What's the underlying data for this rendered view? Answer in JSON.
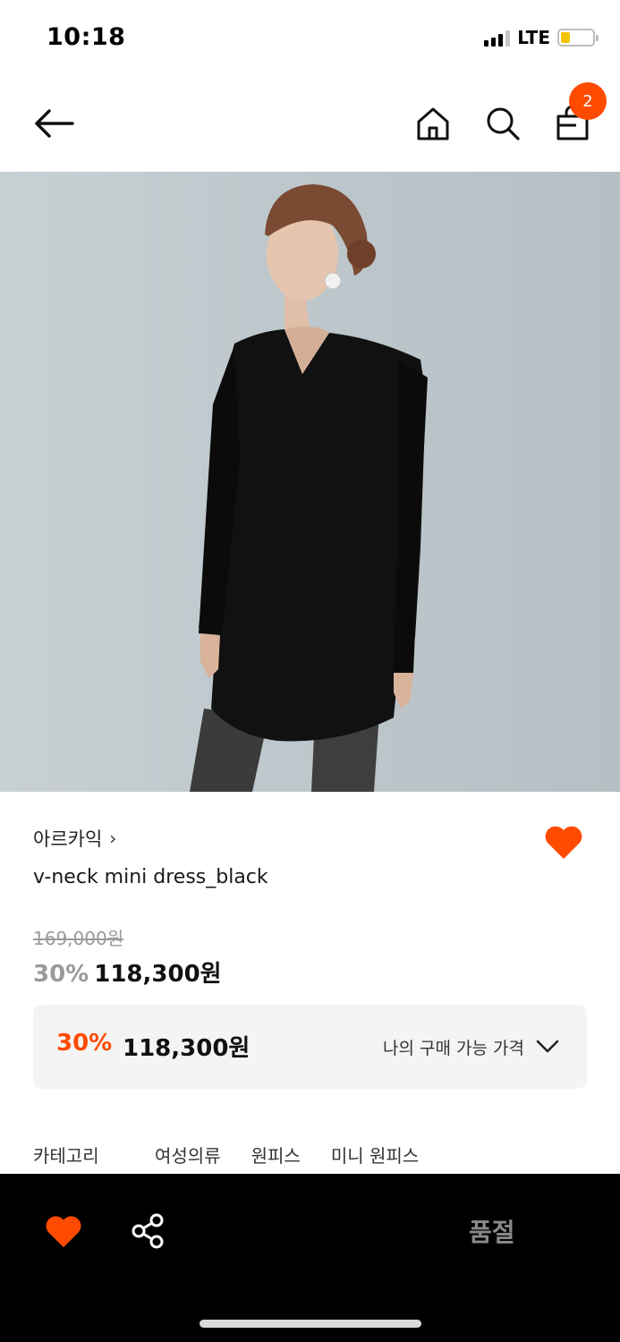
{
  "status_bar": {
    "time": "10:18",
    "network": "LTE",
    "battery_level": 0.3,
    "battery_color": "#f5c400"
  },
  "header": {
    "back_icon": "arrow-left-icon",
    "home_icon": "home-icon",
    "search_icon": "search-icon",
    "bag_icon": "shopping-bag-icon",
    "cart_count": "2",
    "badge_color": "#ff4b00"
  },
  "product": {
    "image_description_icon": "product-photo",
    "brand": "아르카익",
    "brand_chevron": "›",
    "name": "v-neck mini dress_black",
    "original_price": "169,000원",
    "discount_rate": "30%",
    "sale_price": "118,300원",
    "liked": true,
    "accent_color": "#ff4b00"
  },
  "my_price_box": {
    "rate": "30%",
    "price": "118,300원",
    "label": "나의 구매 가능 가격"
  },
  "category": {
    "header": "카테고리",
    "path": [
      "여성의류",
      "원피스",
      "미니 원피스"
    ]
  },
  "bottom_bar": {
    "like_icon": "heart-icon",
    "share_icon": "share-icon",
    "action_label": "품절"
  }
}
